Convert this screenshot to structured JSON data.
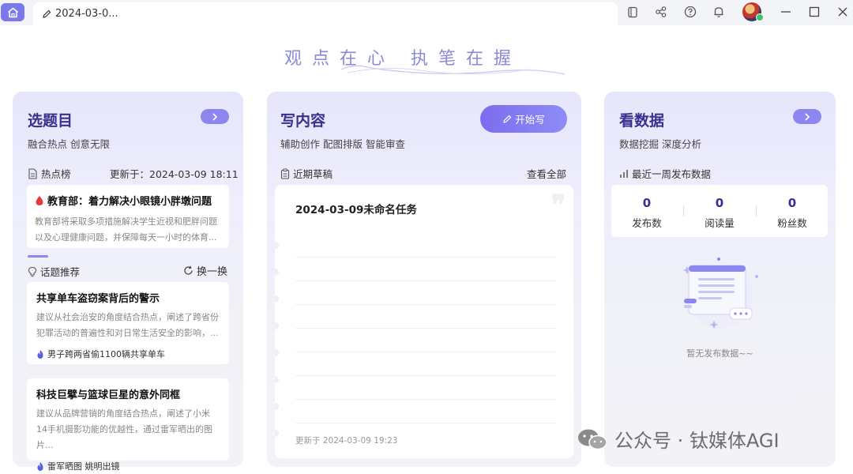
{
  "titlebar": {
    "tab_title": "2024-03-0...",
    "icons": [
      "home-icon",
      "pen-icon",
      "window-icon",
      "share-icon",
      "help-icon",
      "bell-icon",
      "minimize-icon",
      "maximize-icon",
      "close-icon"
    ]
  },
  "slogan": "观点在心 执笔在握",
  "left": {
    "title": "选题目",
    "subtitle": "融合热点 创意无限",
    "hot_label": "热点榜",
    "updated": "更新于：2024-03-09 18:11",
    "hot_item": {
      "title": "教育部：着力解决小眼镜小胖墩问题",
      "desc": "教育部将采取多项措施解决学生近视和肥胖问题以及心理健康问题，并保障每天一小时的体育..."
    },
    "recommend_label": "话题推荐",
    "refresh_label": "换一换",
    "topics": [
      {
        "title": "共享单车盗窃案背后的警示",
        "desc": "建议从社会治安的角度结合热点，阐述了跨省份犯罪活动的普遍性和对日常生活安全的影响，...",
        "tag": "男子跨两省偷1100辆共享单车"
      },
      {
        "title": "科技巨擘与篮球巨星的意外同框",
        "desc": "建议从品牌营销的角度结合热点，阐述了小米14手机摄影功能的优越性，通过雷军晒出的图片...",
        "tag": "雷军晒图 姚明出镜"
      }
    ]
  },
  "middle": {
    "title": "写内容",
    "subtitle": "辅助创作 配图排版 智能审查",
    "start_label": "开始写",
    "drafts_label": "近期草稿",
    "view_all": "查看全部",
    "draft": {
      "title": "2024-03-09未命名任务",
      "updated": "更新于 2024-03-09 19:23"
    }
  },
  "right": {
    "title": "看数据",
    "subtitle": "数据挖掘 深度分析",
    "week_label": "最近一周发布数据",
    "stats": [
      {
        "value": "0",
        "label": "发布数"
      },
      {
        "value": "0",
        "label": "阅读量"
      },
      {
        "value": "0",
        "label": "粉丝数"
      }
    ],
    "empty_text": "暂无发布数据~~"
  },
  "watermark": "公众号 · 钛媒体AGI",
  "colors": {
    "accent": "#7b78ec",
    "title": "#3a2f8c",
    "hot_red": "#e23b3b",
    "flame_blue": "#5a5fe0"
  }
}
